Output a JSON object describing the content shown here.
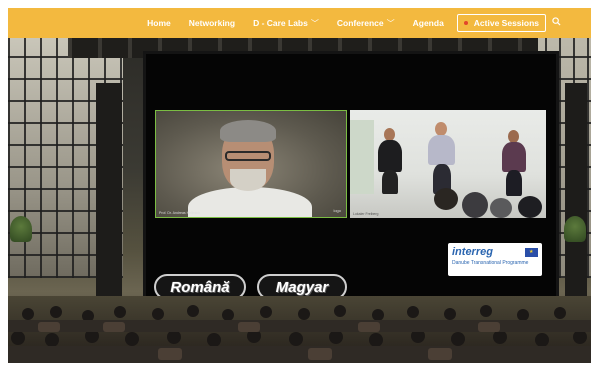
{
  "nav": {
    "home": "Home",
    "networking": "Networking",
    "dcare_labs": "D - Care Labs",
    "conference": "Conference",
    "agenda": "Agenda",
    "active_sessions": "Active Sessions"
  },
  "icons": {
    "search": "search-icon",
    "live_dot": "live-dot-icon",
    "chevron": "chevron-down-icon"
  },
  "colors": {
    "topbar": "#f3b93f",
    "active_border": "#7bbd43",
    "live_dot": "#e2452b"
  },
  "video": {
    "speaker_caption": "Prof. Dr. Andreas Hellmich",
    "speaker_logo": "logo",
    "panel_caption": "Lokaler Freiberg"
  },
  "sponsor": {
    "name": "interreg",
    "subtitle": "Danube Transnational Programme"
  },
  "languages": {
    "romana": "Română",
    "magyar": "Magyar"
  }
}
